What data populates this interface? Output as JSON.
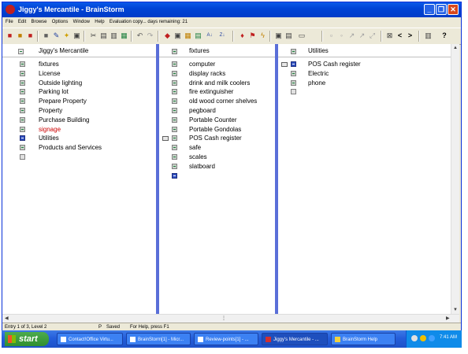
{
  "window": {
    "title": "Jiggy's Mercantile - BrainStorm",
    "minimize_icon": "_",
    "restore_icon": "❐",
    "close_icon": "✕"
  },
  "menu": {
    "file": "File",
    "edit": "Edit",
    "browse": "Browse",
    "options": "Options",
    "window": "Window",
    "help": "Help",
    "evaluation": "Evaluation copy... days remaining: 21"
  },
  "toolbar": {
    "sort_asc": "A↓",
    "sort_desc": "Z↓",
    "back": "<",
    "forward": ">",
    "help": "?"
  },
  "pane1": {
    "header": "Jiggy's Mercantile",
    "items": [
      {
        "label": "fixtures",
        "color": "#000000"
      },
      {
        "label": "License",
        "color": "#000000"
      },
      {
        "label": "Outside lighting",
        "color": "#000000"
      },
      {
        "label": "Parking lot",
        "color": "#000000"
      },
      {
        "label": "Prepare Property",
        "color": "#000000"
      },
      {
        "label": "Property",
        "color": "#000000"
      },
      {
        "label": "Purchase Building",
        "color": "#000000"
      },
      {
        "label": "signage",
        "color": "#cc0000"
      },
      {
        "label": "Utilities",
        "color": "#000000"
      },
      {
        "label": "Products and Services",
        "color": "#000000"
      }
    ]
  },
  "pane2": {
    "header": "fixtures",
    "items": [
      {
        "label": "computer"
      },
      {
        "label": "display racks"
      },
      {
        "label": "drink and milk coolers"
      },
      {
        "label": "fire extinguisher"
      },
      {
        "label": "old wood corner shelves"
      },
      {
        "label": "pegboard"
      },
      {
        "label": "Portable Counter"
      },
      {
        "label": "Portable Gondolas"
      },
      {
        "label": "POS Cash register"
      },
      {
        "label": "safe"
      },
      {
        "label": "scales"
      },
      {
        "label": "slatboard"
      }
    ]
  },
  "pane3": {
    "header": "Utilities",
    "items": [
      {
        "label": "POS Cash register"
      },
      {
        "label": "Electric"
      },
      {
        "label": "phone"
      }
    ]
  },
  "status": {
    "entry": "Entry 1 of 3, Level 2",
    "p": "P",
    "saved": "Saved",
    "help": "For Help, press F1"
  },
  "taskbar": {
    "start": "start",
    "tasks": [
      {
        "label": "Contact!Office Virtu..."
      },
      {
        "label": "BrainStorm[1] - Micr..."
      },
      {
        "label": "Review-points[1] - ..."
      },
      {
        "label": "Jiggy's Mercantile - ..."
      },
      {
        "label": "BrainStorm Help"
      }
    ],
    "clock": "7:41 AM"
  },
  "colors": {
    "titlebar": "#0054e3",
    "pane_divider": "#5a6fd8",
    "taskbar": "#245edb",
    "start_button": "#3c9a3c",
    "highlight_text": "#cc0000"
  }
}
